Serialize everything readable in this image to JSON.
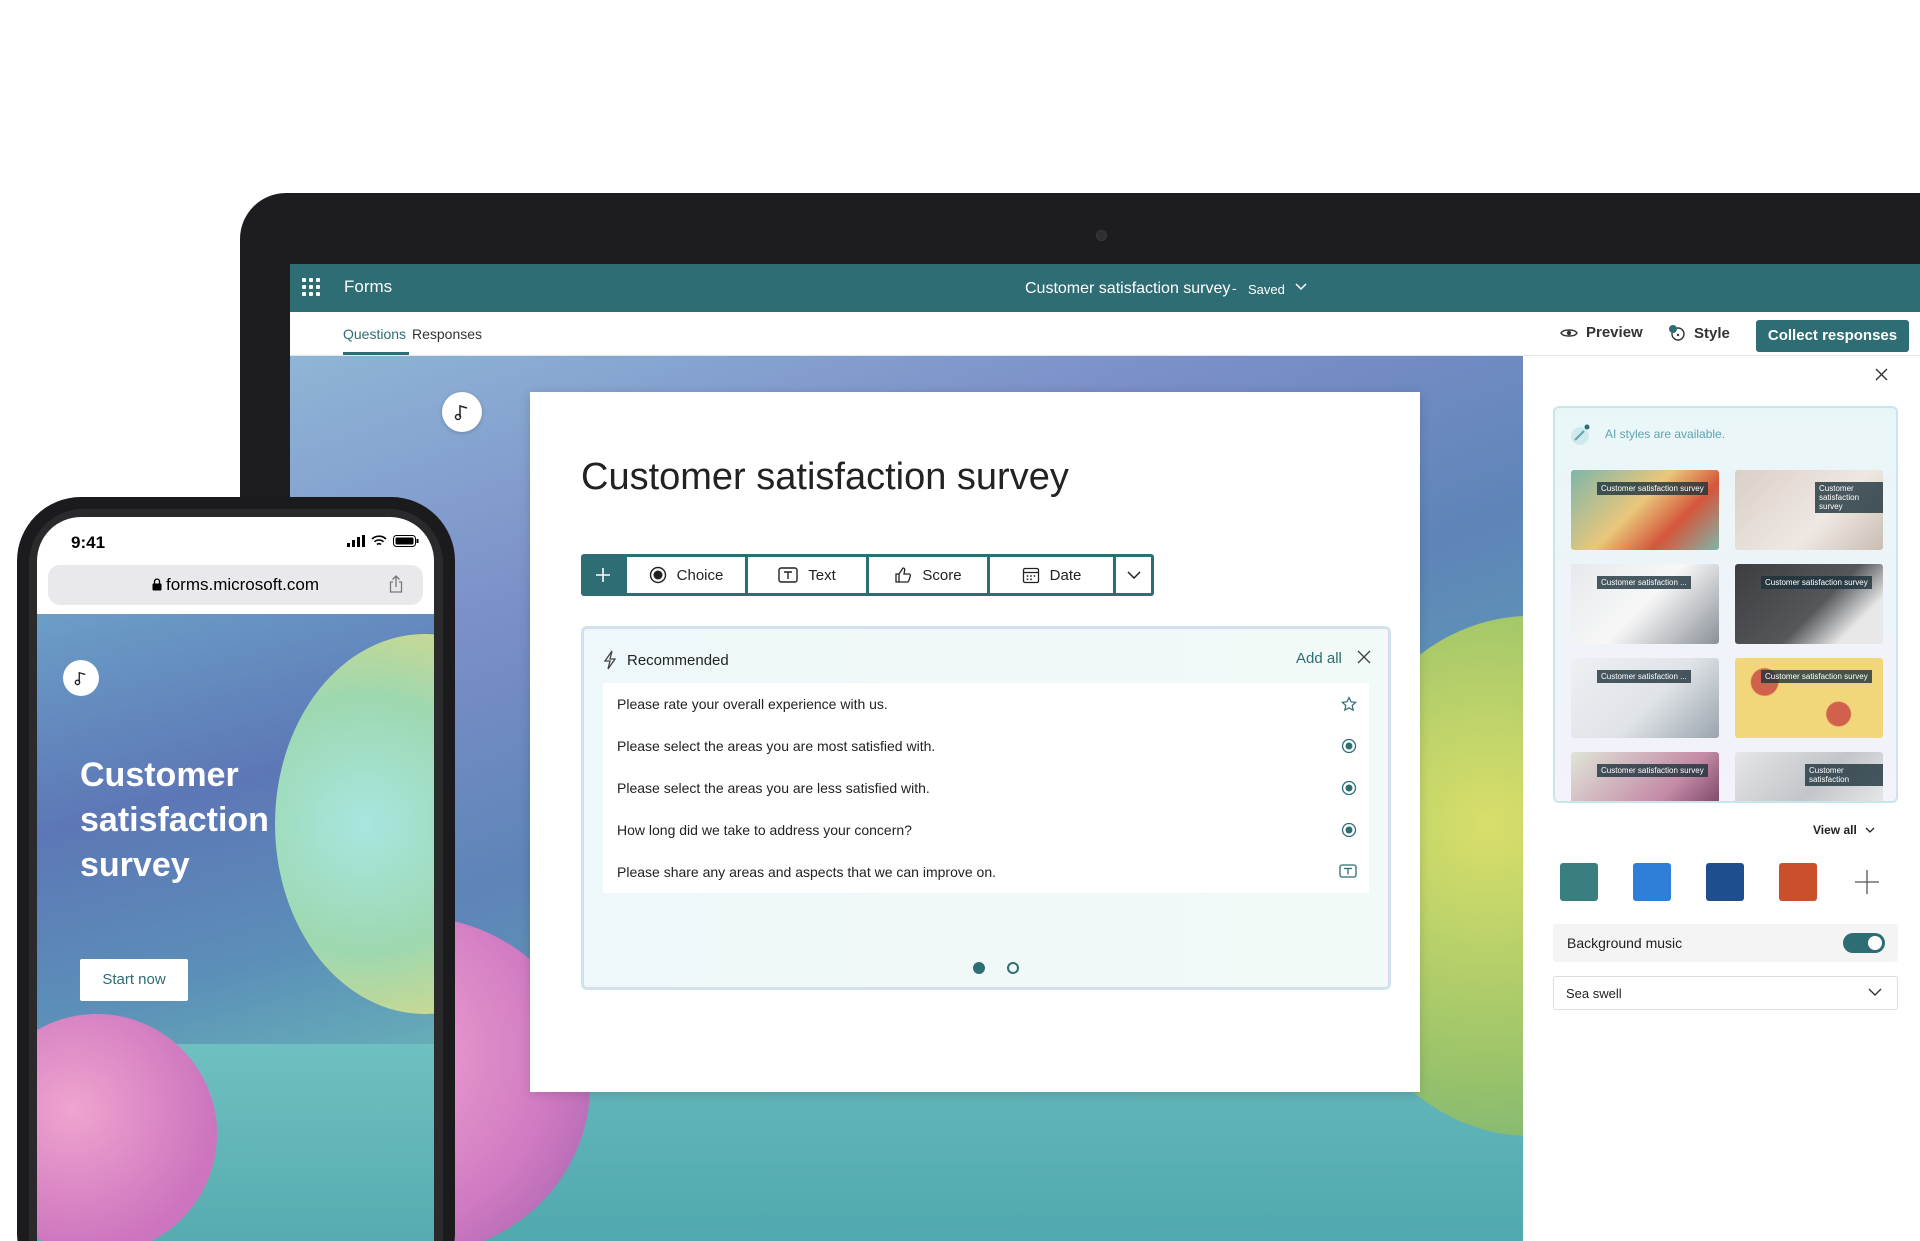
{
  "header": {
    "app_name": "Forms",
    "doc_title": "Customer satisfaction survey",
    "separator": "-",
    "status": "Saved"
  },
  "tabs": [
    {
      "label": "Questions",
      "active": true
    },
    {
      "label": "Responses",
      "active": false
    }
  ],
  "actions": {
    "preview": "Preview",
    "style": "Style",
    "collect": "Collect responses"
  },
  "form": {
    "title": "Customer satisfaction survey",
    "toolbar": [
      "Choice",
      "Text",
      "Score",
      "Date"
    ]
  },
  "recommended": {
    "label": "Recommended",
    "add_all": "Add all",
    "items": [
      {
        "text": "Please rate your overall experience with us.",
        "icon": "star-icon"
      },
      {
        "text": "Please select the areas you are most satisfied with.",
        "icon": "radio-icon"
      },
      {
        "text": "Please select the areas you are less satisfied with.",
        "icon": "radio-icon"
      },
      {
        "text": "How long did we take to address your concern?",
        "icon": "radio-icon"
      },
      {
        "text": "Please share any areas and aspects that we can improve on.",
        "icon": "text-icon"
      }
    ],
    "page": 1,
    "pages": 2
  },
  "style_panel": {
    "ai_notice": "AI styles are available.",
    "view_all": "View all",
    "swatches": [
      "#3a7f80",
      "#2f7ed8",
      "#1f4e8f",
      "#c9502a"
    ],
    "music_label": "Background music",
    "music_on": true,
    "music_value": "Sea swell",
    "thumbnails": [
      {
        "label": "Customer satisfaction survey"
      },
      {
        "label": "Customer satisfaction survey"
      },
      {
        "label": "Customer satisfaction ..."
      },
      {
        "label": "Customer satisfaction survey"
      },
      {
        "label": "Customer satisfaction ..."
      },
      {
        "label": "Customer satisfaction survey"
      },
      {
        "label": "Customer satisfaction survey"
      },
      {
        "label": "Customer satisfaction"
      }
    ]
  },
  "phone": {
    "time": "9:41",
    "url": "forms.microsoft.com",
    "title": "Customer satisfaction survey",
    "start": "Start now"
  },
  "colors": {
    "accent": "#2e6d73"
  }
}
